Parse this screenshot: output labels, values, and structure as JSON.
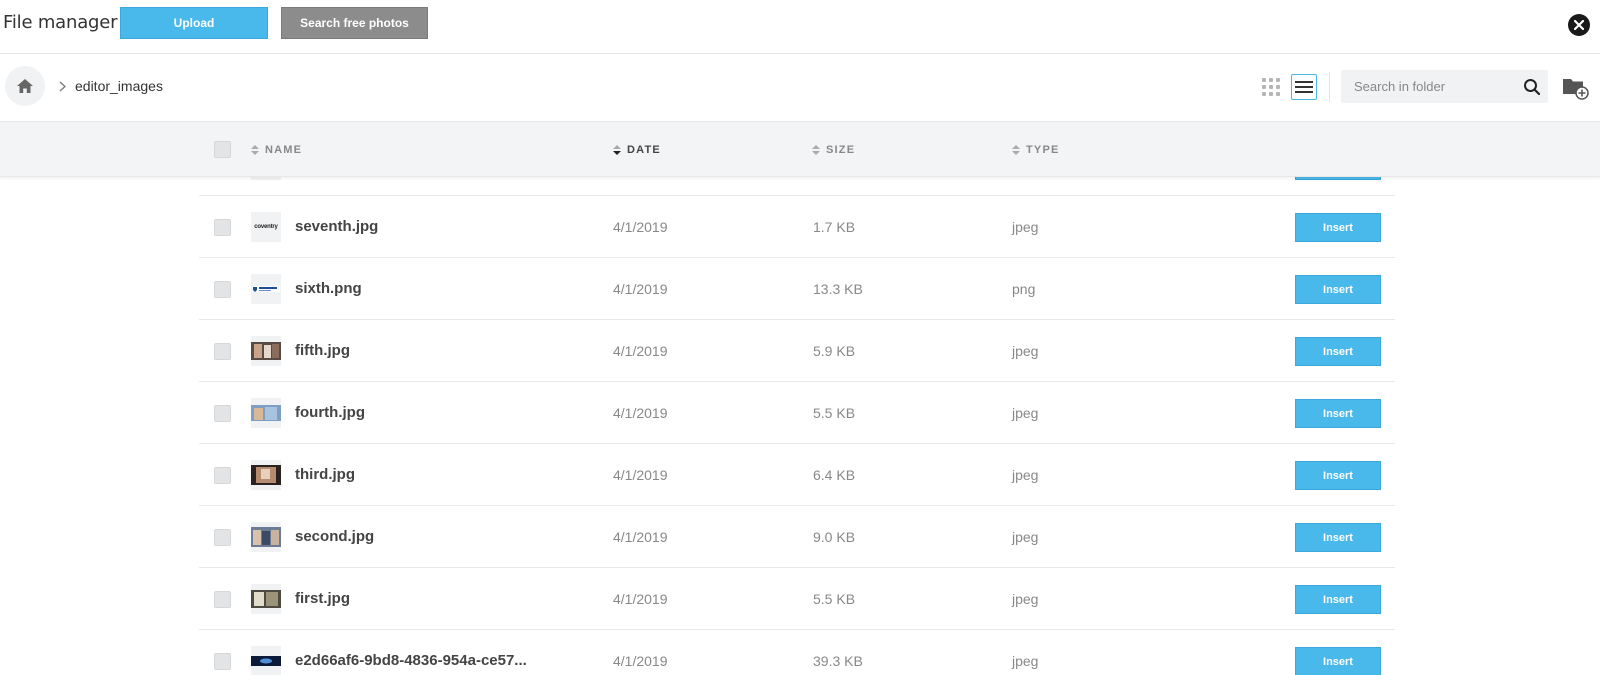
{
  "header": {
    "title": "File manager",
    "upload_label": "Upload",
    "search_photos_label": "Search free photos"
  },
  "breadcrumb": {
    "current": "editor_images"
  },
  "search": {
    "placeholder": "Search in folder"
  },
  "table": {
    "columns": {
      "name": "NAME",
      "date": "DATE",
      "size": "SIZE",
      "type": "TYPE"
    },
    "sorted_by": "DATE",
    "insert_label": "Insert",
    "rows": [
      {
        "name": "seventh.jpg",
        "date": "4/1/2019",
        "size": "1.7 KB",
        "type": "jpeg",
        "thumb_text": "coventry"
      },
      {
        "name": "sixth.png",
        "date": "4/1/2019",
        "size": "13.3 KB",
        "type": "png"
      },
      {
        "name": "fifth.jpg",
        "date": "4/1/2019",
        "size": "5.9 KB",
        "type": "jpeg"
      },
      {
        "name": "fourth.jpg",
        "date": "4/1/2019",
        "size": "5.5 KB",
        "type": "jpeg"
      },
      {
        "name": "third.jpg",
        "date": "4/1/2019",
        "size": "6.4 KB",
        "type": "jpeg"
      },
      {
        "name": "second.jpg",
        "date": "4/1/2019",
        "size": "9.0 KB",
        "type": "jpeg"
      },
      {
        "name": "first.jpg",
        "date": "4/1/2019",
        "size": "5.5 KB",
        "type": "jpeg"
      },
      {
        "name": "e2d66af6-9bd8-4836-954a-ce57...",
        "date": "4/1/2019",
        "size": "39.3 KB",
        "type": "jpeg"
      }
    ]
  },
  "colors": {
    "accent": "#49b8ea",
    "secondary_button": "#8c8c8c",
    "header_bg": "#f3f4f6"
  },
  "icons": [
    "home-icon",
    "chevron-right-icon",
    "grid-view-icon",
    "list-view-icon",
    "search-icon",
    "new-folder-icon",
    "close-icon"
  ]
}
